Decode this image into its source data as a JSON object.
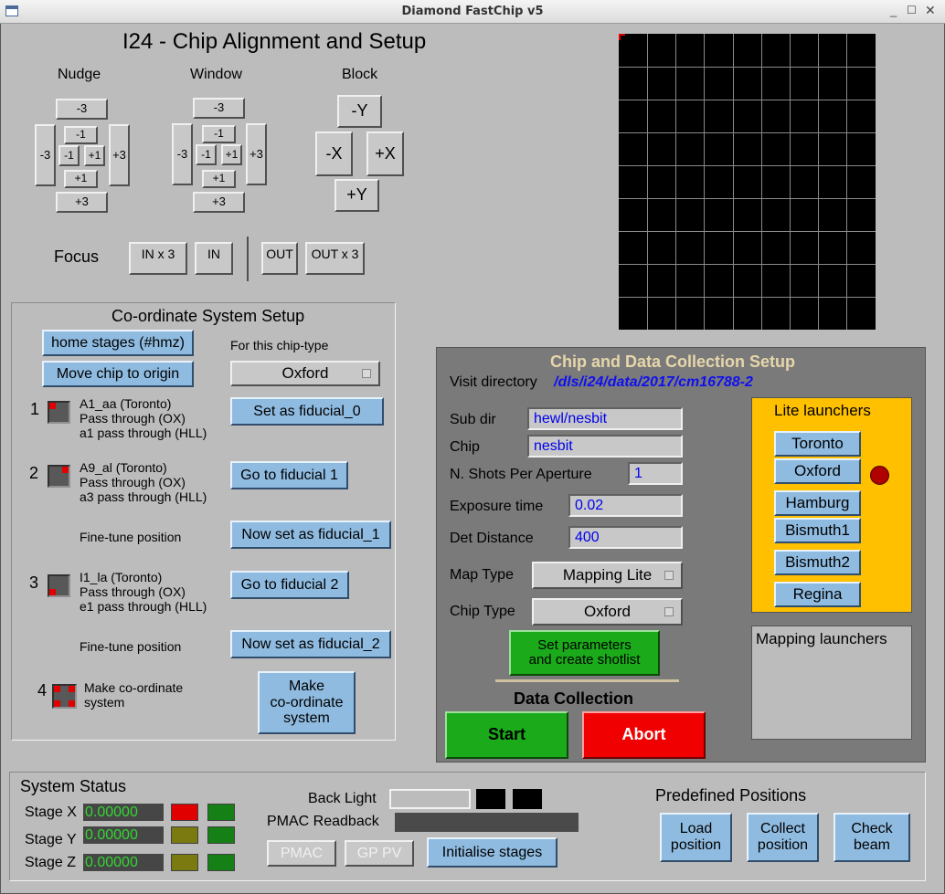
{
  "window": {
    "title": "Diamond FastChip v5"
  },
  "alignment": {
    "title": "I24 - Chip Alignment and Setup",
    "nudge": {
      "label": "Nudge",
      "top": "-3",
      "bottom": "+3",
      "left": "-3",
      "right": "+3",
      "in_top": "-1",
      "in_bottom": "+1",
      "in_left": "-1",
      "in_right": "+1"
    },
    "window": {
      "label": "Window",
      "top": "-3",
      "bottom": "+3",
      "left": "-3",
      "right": "+3",
      "in_top": "-1",
      "in_bottom": "+1",
      "in_left": "-1",
      "in_right": "+1"
    },
    "block": {
      "label": "Block",
      "minus_y": "-Y",
      "minus_x": "-X",
      "plus_x": "+X",
      "plus_y": "+Y"
    },
    "focus": {
      "label": "Focus",
      "in_x3": "IN x 3",
      "in": "IN",
      "out": "OUT",
      "out_x3": "OUT x 3"
    }
  },
  "coord": {
    "title": "Co-ordinate System Setup",
    "home_stages": "home stages (#hmz)",
    "move_chip": "Move chip to origin",
    "chip_type_label": "For this chip-type",
    "chip_type_value": "Oxford",
    "f1_num": "1",
    "f1_line1": "A1_aa (Toronto)",
    "f1_line2": "Pass through (OX)",
    "f1_line3": "a1 pass through (HLL)",
    "set_fid0": "Set as fiducial_0",
    "f2_num": "2",
    "f2_line1": "A9_al (Toronto)",
    "f2_line2": "Pass through (OX)",
    "f2_line3": "a3 pass through (HLL)",
    "goto_fid1": "Go to fiducial 1",
    "fine_tune_1": "Fine-tune position",
    "set_fid1": "Now set as fiducial_1",
    "f3_num": "3",
    "f3_line1": "I1_la (Toronto)",
    "f3_line2": "Pass through (OX)",
    "f3_line3": "e1 pass through (HLL)",
    "goto_fid2": "Go to fiducial 2",
    "fine_tune_2": "Fine-tune position",
    "set_fid2": "Now set as fiducial_2",
    "f4_num": "4",
    "make_label_1": "Make co-ordinate",
    "make_label_2": "system",
    "make_btn_1": "Make",
    "make_btn_2": "co-ordinate",
    "make_btn_3": "system"
  },
  "dc": {
    "title": "Chip and Data Collection Setup",
    "visit_label": "Visit directory",
    "visit_value": "/dls/i24/data/2017/cm16788-2",
    "subdir_label": "Sub dir",
    "subdir_value": "hewl/nesbit",
    "chip_label": "Chip",
    "chip_value": "nesbit",
    "shots_label": "N. Shots Per Aperture",
    "shots_value": "1",
    "exp_label": "Exposure time",
    "exp_value": "0.02",
    "det_label": "Det Distance",
    "det_value": "400",
    "map_label": "Map Type",
    "map_value": "Mapping Lite",
    "chiptype_label": "Chip Type",
    "chiptype_value": "Oxford",
    "setparams_1": "Set parameters",
    "setparams_2": "and create shotlist",
    "collection_title": "Data Collection",
    "start": "Start",
    "abort": "Abort",
    "lite_title": "Lite launchers",
    "lite": [
      "Toronto",
      "Oxford",
      "Hamburg",
      "Bismuth1",
      "Bismuth2",
      "Regina"
    ],
    "mapping_title": "Mapping launchers"
  },
  "status": {
    "title": "System Status",
    "stage_x": "Stage X",
    "stage_y": "Stage Y",
    "stage_z": "Stage Z",
    "x_val": "0.00000",
    "y_val": "0.00000",
    "z_val": "0.00000",
    "back_light": "Back Light",
    "pmac_readback": "PMAC Readback",
    "pmac": "PMAC",
    "gp_pv": "GP PV",
    "init": "Initialise stages"
  },
  "predef": {
    "title": "Predefined Positions",
    "load_1": "Load",
    "load_2": "position",
    "collect_1": "Collect",
    "collect_2": "position",
    "check_1": "Check",
    "check_2": "beam"
  },
  "colors": {
    "panel_bg": "#bcbcbc",
    "dark_panel": "#7a7a7a",
    "blue_button": "#8fbbe0",
    "start": "#1aaa1a",
    "abort": "#f00000",
    "lite_panel": "#ffc000"
  }
}
